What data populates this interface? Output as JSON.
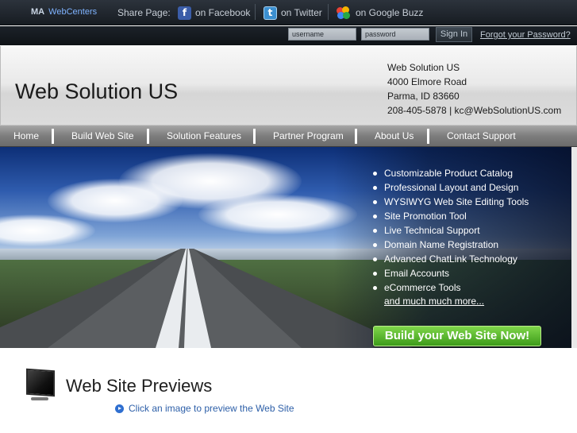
{
  "topbar": {
    "brand_ma": "MA",
    "brand_wc": "WebCenters",
    "share_label": "Share Page:",
    "share_links": [
      {
        "label": "on Facebook",
        "icon": "facebook-icon"
      },
      {
        "label": "on Twitter",
        "icon": "twitter-icon"
      },
      {
        "label": "on Google Buzz",
        "icon": "google-buzz-icon"
      }
    ]
  },
  "login": {
    "username_placeholder": "username",
    "password_placeholder": "password",
    "signin_label": "Sign In",
    "forgot_label": "Forgot your Password?"
  },
  "header": {
    "site_title": "Web Solution US",
    "address_lines": [
      "Web Solution US",
      "4000 Elmore Road",
      "Parma, ID 83660",
      "208-405-5878 | kc@WebSolutionUS.com"
    ]
  },
  "nav": {
    "items": [
      "Home",
      "Build Web Site",
      "Solution Features",
      "Partner Program",
      "About Us",
      "Contact Support"
    ]
  },
  "hero": {
    "features": [
      "Customizable Product Catalog",
      "Professional Layout and Design",
      "WYSIWYG Web Site Editing Tools",
      "Site Promotion Tool",
      "Live Technical Support",
      "Domain Name Registration",
      "Advanced ChatLink Technology",
      "Email Accounts",
      "eCommerce Tools"
    ],
    "more_link": "and much much more...",
    "cta_label": "Build your Web Site Now!",
    "cta_color": "#5cb82e"
  },
  "previews": {
    "title": "Web Site Previews",
    "hint": "Click an image to preview the Web Site",
    "hint_icon": "play-icon"
  },
  "colors": {
    "link_blue": "#2d5fa8",
    "dark_bar": "#1b2027",
    "nav_gray": "#8a8a8a"
  }
}
